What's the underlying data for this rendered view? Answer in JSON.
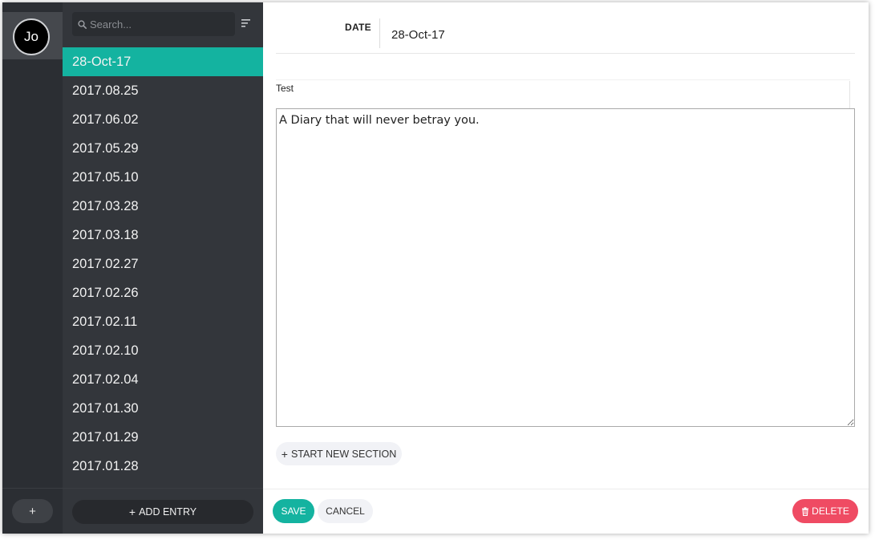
{
  "user": {
    "initials": "Jo"
  },
  "rail": {
    "add_label": "+"
  },
  "search": {
    "placeholder": "Search..."
  },
  "entries": [
    {
      "label": "28-Oct-17",
      "active": true
    },
    {
      "label": "2017.08.25"
    },
    {
      "label": "2017.06.02"
    },
    {
      "label": "2017.05.29"
    },
    {
      "label": "2017.05.10"
    },
    {
      "label": "2017.03.28"
    },
    {
      "label": "2017.03.18"
    },
    {
      "label": "2017.02.27"
    },
    {
      "label": "2017.02.26"
    },
    {
      "label": "2017.02.11"
    },
    {
      "label": "2017.02.10"
    },
    {
      "label": "2017.02.04"
    },
    {
      "label": "2017.01.30"
    },
    {
      "label": "2017.01.29"
    },
    {
      "label": "2017.01.28"
    }
  ],
  "add_entry": {
    "plus": "+",
    "label": "ADD ENTRY"
  },
  "editor": {
    "date_label": "DATE",
    "date_value": "28-Oct-17",
    "section_title": "Test",
    "body_text": "A Diary that will never betray you."
  },
  "new_section": {
    "plus": "+",
    "label": "START NEW SECTION"
  },
  "actions": {
    "save": "SAVE",
    "cancel": "CANCEL",
    "delete": "DELETE"
  },
  "colors": {
    "accent": "#14b3a0",
    "danger": "#ef4b63",
    "sidebar_dark": "#2b2e33",
    "list_bg": "#33363b"
  },
  "icons": {
    "search": "search-icon",
    "sort": "sort-icon",
    "trash": "trash-icon"
  }
}
